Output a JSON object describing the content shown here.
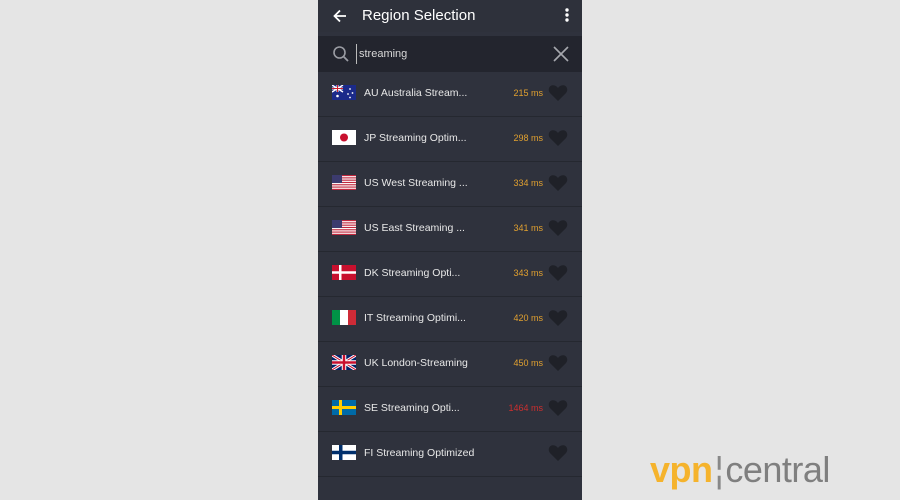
{
  "header": {
    "title": "Region Selection",
    "back_icon": "arrow-left-icon",
    "menu_icon": "more-vertical-icon"
  },
  "search": {
    "value": "streaming",
    "placeholder": "Search",
    "search_icon": "search-icon",
    "clear_icon": "close-icon"
  },
  "colors": {
    "latency_ok": "#e0a030",
    "latency_high": "#cc2f2f",
    "logo_accent": "#f5b32c"
  },
  "regions": [
    {
      "flag": "AU",
      "name": "AU Australia Stream...",
      "latency": "215 ms",
      "status": "ok"
    },
    {
      "flag": "JP",
      "name": "JP Streaming Optim...",
      "latency": "298 ms",
      "status": "ok"
    },
    {
      "flag": "US",
      "name": "US West Streaming ...",
      "latency": "334 ms",
      "status": "ok"
    },
    {
      "flag": "US",
      "name": "US East Streaming ...",
      "latency": "341 ms",
      "status": "ok"
    },
    {
      "flag": "DK",
      "name": "DK Streaming Opti...",
      "latency": "343 ms",
      "status": "ok"
    },
    {
      "flag": "IT",
      "name": "IT Streaming Optimi...",
      "latency": "420 ms",
      "status": "ok"
    },
    {
      "flag": "UK",
      "name": "UK London-Streaming",
      "latency": "450 ms",
      "status": "ok"
    },
    {
      "flag": "SE",
      "name": "SE Streaming Opti...",
      "latency": "1464 ms",
      "status": "high"
    },
    {
      "flag": "FI",
      "name": "FI Streaming Optimized",
      "latency": "",
      "status": "none"
    }
  ],
  "watermark": {
    "part1": "vpn",
    "part2": "central"
  }
}
